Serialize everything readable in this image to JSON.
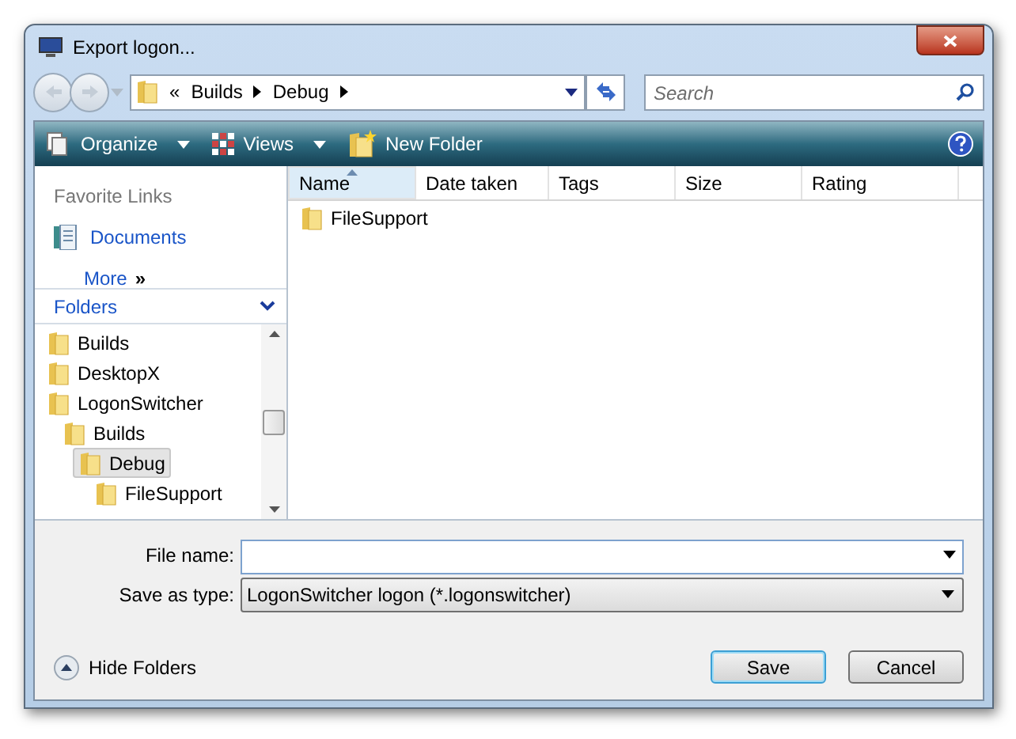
{
  "window": {
    "title": "Export logon..."
  },
  "address": {
    "overflow": "«",
    "crumbs": [
      "Builds",
      "Debug"
    ]
  },
  "search": {
    "placeholder": "Search"
  },
  "toolbar": {
    "items": [
      {
        "label": "Organize",
        "kind": "organize"
      },
      {
        "label": "Views",
        "kind": "views"
      },
      {
        "label": "New Folder",
        "kind": "newfolder"
      }
    ]
  },
  "favorite_links": {
    "title": "Favorite Links",
    "items": [
      {
        "label": "Documents"
      }
    ],
    "more": "More",
    "more_glyph": "»"
  },
  "folders": {
    "title": "Folders",
    "tree": [
      {
        "label": "Builds",
        "selected": false
      },
      {
        "label": "DesktopX",
        "selected": false
      },
      {
        "label": "LogonSwitcher",
        "selected": false,
        "children": [
          {
            "label": "Builds",
            "selected": false,
            "children": [
              {
                "label": "Debug",
                "selected": true,
                "children": [
                  {
                    "label": "FileSupport",
                    "selected": false
                  }
                ]
              }
            ]
          }
        ]
      }
    ]
  },
  "table": {
    "columns": [
      {
        "label": "Name",
        "sorted": true
      },
      {
        "label": "Date taken",
        "sorted": false
      },
      {
        "label": "Tags",
        "sorted": false
      },
      {
        "label": "Size",
        "sorted": false
      },
      {
        "label": "Rating",
        "sorted": false
      }
    ],
    "rows": [
      {
        "name": "FileSupport"
      }
    ]
  },
  "form": {
    "file_name": {
      "label": "File name:"
    },
    "save_as_type": {
      "label": "Save as type:",
      "value": "LogonSwitcher logon (*.logonswitcher)"
    }
  },
  "hide_folders": "Hide Folders",
  "buttons": [
    {
      "label": "Save",
      "default": true
    },
    {
      "label": "Cancel",
      "default": false
    }
  ]
}
